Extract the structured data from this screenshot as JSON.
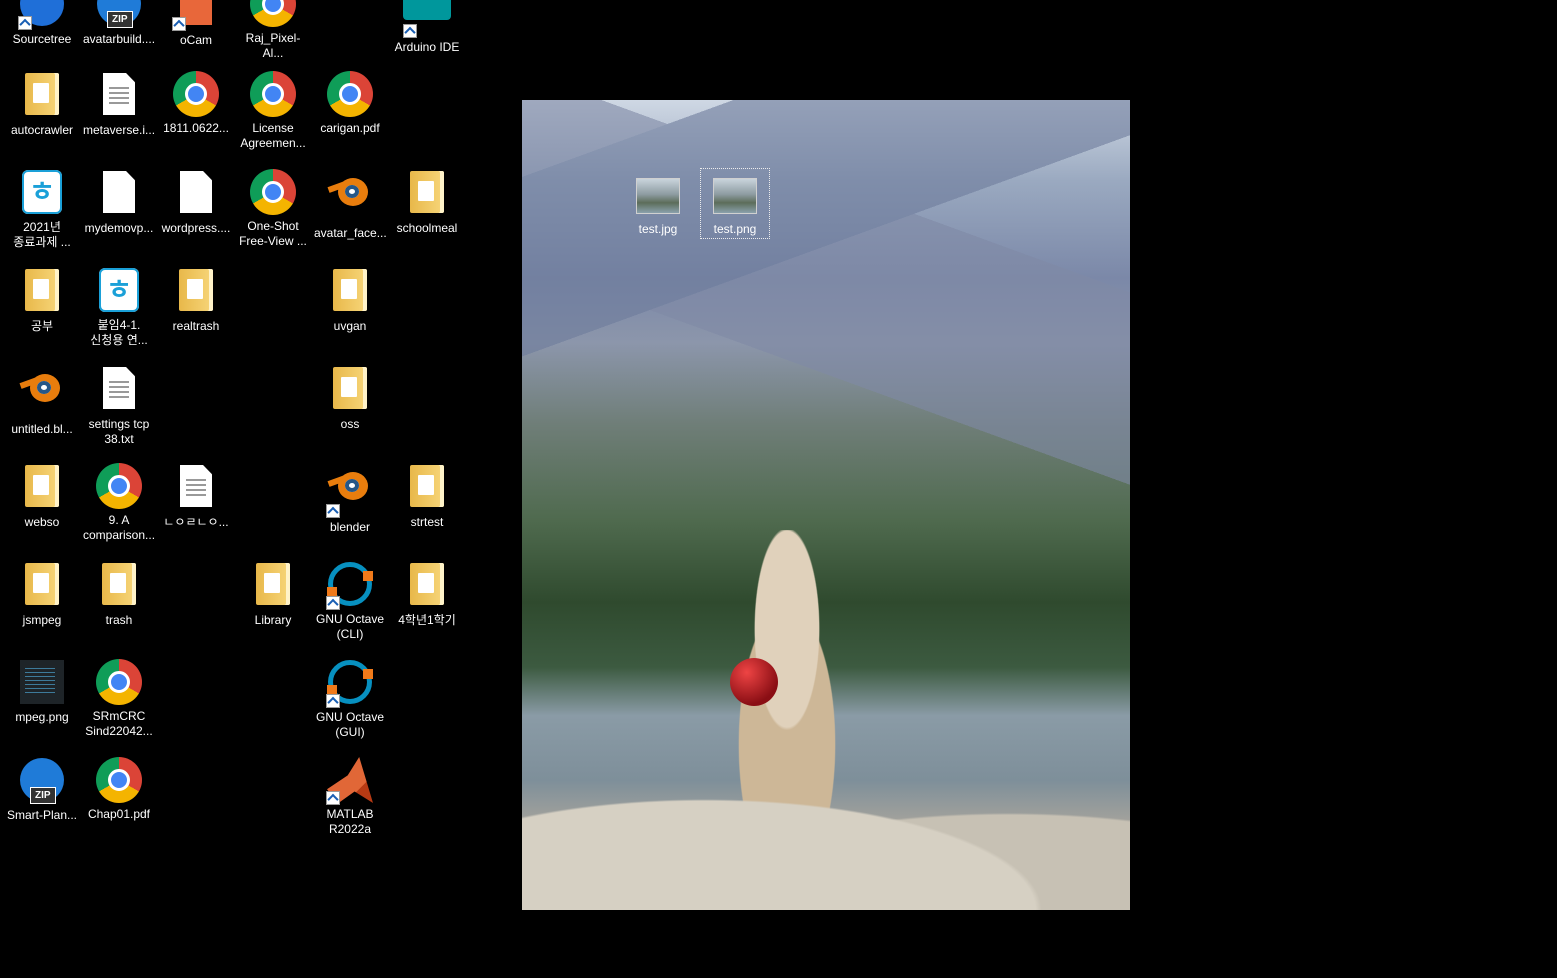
{
  "desktop": {
    "icons": [
      {
        "name": "sourcetree",
        "label": "Sourcetree"
      },
      {
        "name": "avatarbuild",
        "label": "avatarbuild...."
      },
      {
        "name": "ocam",
        "label": "oCam"
      },
      {
        "name": "raj-pixel",
        "label": "Raj_Pixel-Al..."
      },
      {
        "name": "arduino-ide",
        "label": "Arduino IDE"
      },
      {
        "name": "autocrawler",
        "label": "autocrawler"
      },
      {
        "name": "metaverse",
        "label": "metaverse.i..."
      },
      {
        "name": "pdf-1811",
        "label": "1811.0622..."
      },
      {
        "name": "license-agreement",
        "label": "License\nAgreemen..."
      },
      {
        "name": "carigan",
        "label": "carigan.pdf"
      },
      {
        "name": "hwp-2021",
        "label": "2021년\n종료과제 ..."
      },
      {
        "name": "mydemovp",
        "label": "mydemovp..."
      },
      {
        "name": "wordpress",
        "label": "wordpress...."
      },
      {
        "name": "one-shot",
        "label": "One-Shot\nFree-View ..."
      },
      {
        "name": "avatar-face",
        "label": "avatar_face..."
      },
      {
        "name": "schoolmeal",
        "label": "schoolmeal"
      },
      {
        "name": "gongbu",
        "label": "공부"
      },
      {
        "name": "hwp-attach",
        "label": "붙임4-1.\n신청용 연..."
      },
      {
        "name": "realtrash",
        "label": "realtrash"
      },
      {
        "name": "uvgan",
        "label": "uvgan"
      },
      {
        "name": "untitled-blend",
        "label": "untitled.bl..."
      },
      {
        "name": "settings-tcp",
        "label": "settings tcp\n38.txt"
      },
      {
        "name": "oss",
        "label": "oss"
      },
      {
        "name": "webso",
        "label": "webso"
      },
      {
        "name": "comparison",
        "label": "9. A\ncomparison..."
      },
      {
        "name": "korean-txt",
        "label": "ㄴㅇㄹㄴㅇ..."
      },
      {
        "name": "blender",
        "label": "blender"
      },
      {
        "name": "strtest",
        "label": "strtest"
      },
      {
        "name": "jsmpeg",
        "label": "jsmpeg"
      },
      {
        "name": "trash",
        "label": "trash"
      },
      {
        "name": "library",
        "label": "Library"
      },
      {
        "name": "octave-cli",
        "label": "GNU Octave\n(CLI)"
      },
      {
        "name": "semester",
        "label": "4학년1학기"
      },
      {
        "name": "mpeg-png",
        "label": "mpeg.png"
      },
      {
        "name": "srmcrc",
        "label": "SRmCRC\nSind22042..."
      },
      {
        "name": "octave-gui",
        "label": "GNU Octave\n(GUI)"
      },
      {
        "name": "smart-plan",
        "label": "Smart-Plan..."
      },
      {
        "name": "chap01",
        "label": "Chap01.pdf"
      },
      {
        "name": "matlab",
        "label": "MATLAB\nR2022a"
      }
    ],
    "wallpaper_icons": [
      {
        "name": "test-jpg",
        "label": "test.jpg"
      },
      {
        "name": "test-png",
        "label": "test.png"
      }
    ]
  },
  "colors": {
    "background": "#000000",
    "label": "#ffffff"
  }
}
